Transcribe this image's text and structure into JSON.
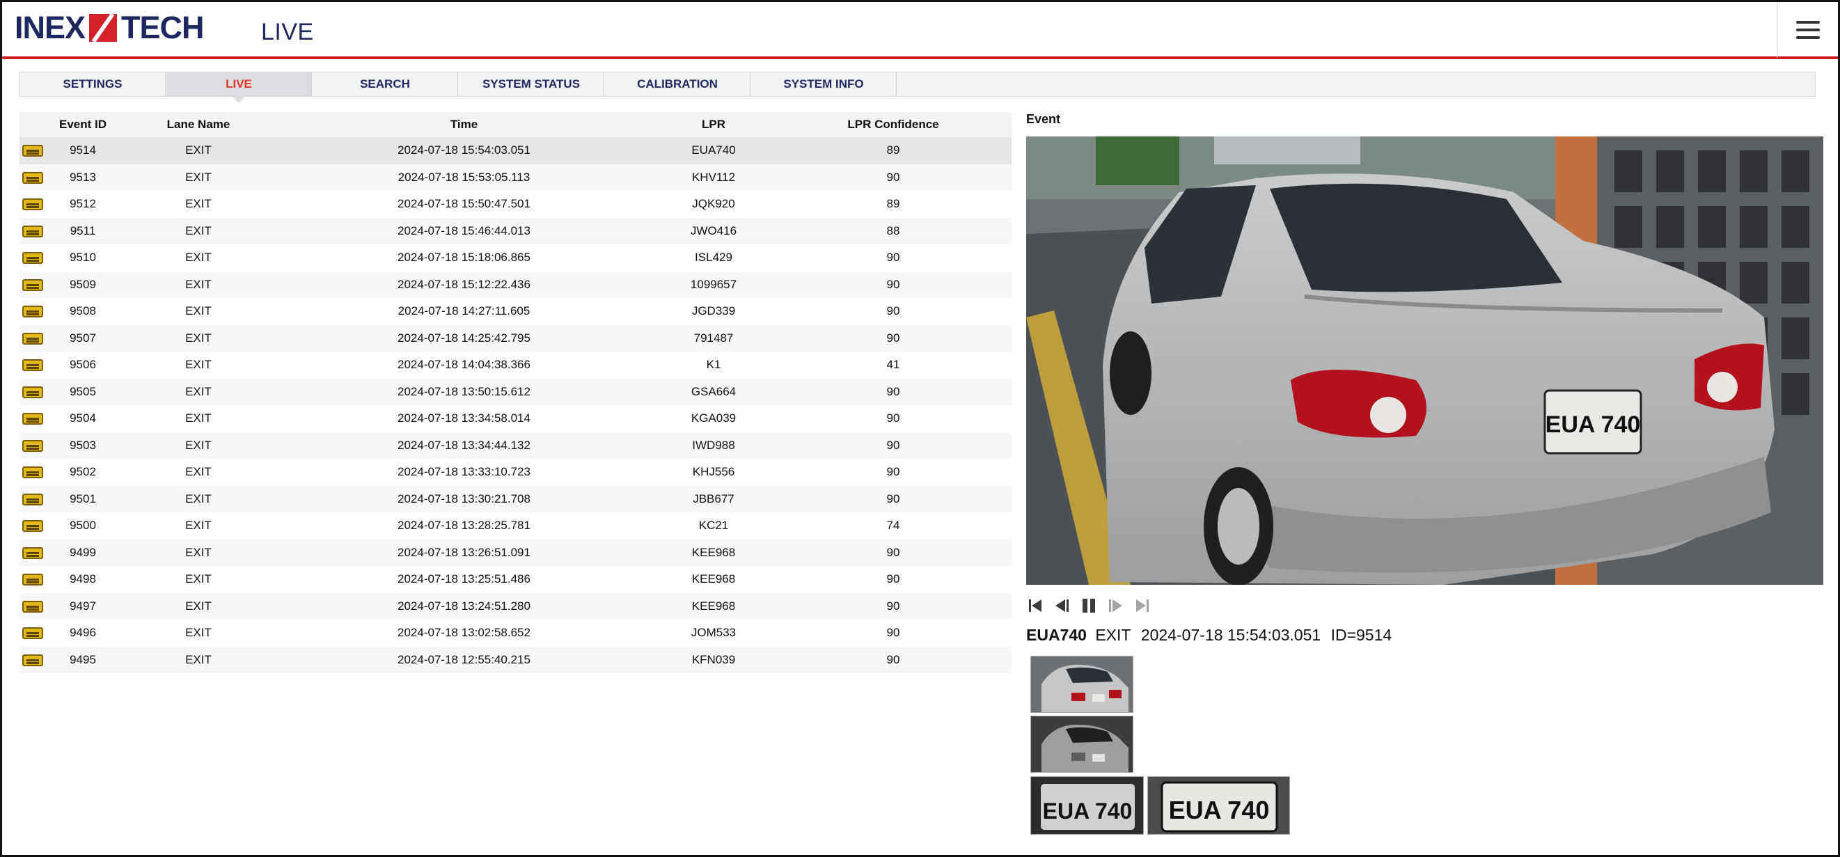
{
  "header": {
    "logo_left": "INEX",
    "logo_right": "TECH",
    "page_title": "LIVE"
  },
  "tabs": [
    {
      "label": "SETTINGS",
      "active": false
    },
    {
      "label": "LIVE",
      "active": true
    },
    {
      "label": "SEARCH",
      "active": false
    },
    {
      "label": "SYSTEM STATUS",
      "active": false
    },
    {
      "label": "CALIBRATION",
      "active": false
    },
    {
      "label": "SYSTEM INFO",
      "active": false
    }
  ],
  "table": {
    "columns": [
      "",
      "Event ID",
      "Lane Name",
      "Time",
      "LPR",
      "LPR Confidence"
    ],
    "rows": [
      {
        "id": "9514",
        "lane": "EXIT",
        "time": "2024-07-18 15:54:03.051",
        "lpr": "EUA740",
        "conf": "89"
      },
      {
        "id": "9513",
        "lane": "EXIT",
        "time": "2024-07-18 15:53:05.113",
        "lpr": "KHV112",
        "conf": "90"
      },
      {
        "id": "9512",
        "lane": "EXIT",
        "time": "2024-07-18 15:50:47.501",
        "lpr": "JQK920",
        "conf": "89"
      },
      {
        "id": "9511",
        "lane": "EXIT",
        "time": "2024-07-18 15:46:44.013",
        "lpr": "JWO416",
        "conf": "88"
      },
      {
        "id": "9510",
        "lane": "EXIT",
        "time": "2024-07-18 15:18:06.865",
        "lpr": "ISL429",
        "conf": "90"
      },
      {
        "id": "9509",
        "lane": "EXIT",
        "time": "2024-07-18 15:12:22.436",
        "lpr": "1099657",
        "conf": "90"
      },
      {
        "id": "9508",
        "lane": "EXIT",
        "time": "2024-07-18 14:27:11.605",
        "lpr": "JGD339",
        "conf": "90"
      },
      {
        "id": "9507",
        "lane": "EXIT",
        "time": "2024-07-18 14:25:42.795",
        "lpr": "791487",
        "conf": "90"
      },
      {
        "id": "9506",
        "lane": "EXIT",
        "time": "2024-07-18 14:04:38.366",
        "lpr": "K1",
        "conf": "41"
      },
      {
        "id": "9505",
        "lane": "EXIT",
        "time": "2024-07-18 13:50:15.612",
        "lpr": "GSA664",
        "conf": "90"
      },
      {
        "id": "9504",
        "lane": "EXIT",
        "time": "2024-07-18 13:34:58.014",
        "lpr": "KGA039",
        "conf": "90"
      },
      {
        "id": "9503",
        "lane": "EXIT",
        "time": "2024-07-18 13:34:44.132",
        "lpr": "IWD988",
        "conf": "90"
      },
      {
        "id": "9502",
        "lane": "EXIT",
        "time": "2024-07-18 13:33:10.723",
        "lpr": "KHJ556",
        "conf": "90"
      },
      {
        "id": "9501",
        "lane": "EXIT",
        "time": "2024-07-18 13:30:21.708",
        "lpr": "JBB677",
        "conf": "90"
      },
      {
        "id": "9500",
        "lane": "EXIT",
        "time": "2024-07-18 13:28:25.781",
        "lpr": "KC21",
        "conf": "74"
      },
      {
        "id": "9499",
        "lane": "EXIT",
        "time": "2024-07-18 13:26:51.091",
        "lpr": "KEE968",
        "conf": "90"
      },
      {
        "id": "9498",
        "lane": "EXIT",
        "time": "2024-07-18 13:25:51.486",
        "lpr": "KEE968",
        "conf": "90"
      },
      {
        "id": "9497",
        "lane": "EXIT",
        "time": "2024-07-18 13:24:51.280",
        "lpr": "KEE968",
        "conf": "90"
      },
      {
        "id": "9496",
        "lane": "EXIT",
        "time": "2024-07-18 13:02:58.652",
        "lpr": "JOM533",
        "conf": "90"
      },
      {
        "id": "9495",
        "lane": "EXIT",
        "time": "2024-07-18 12:55:40.215",
        "lpr": "KFN039",
        "conf": "90"
      }
    ]
  },
  "event": {
    "label": "Event",
    "plate": "EUA740",
    "lane": "EXIT",
    "time": "2024-07-18 15:54:03.051",
    "id_text": "ID=9514",
    "plate_text_in_image": "EUA 740"
  },
  "player": {
    "icons": [
      "skip-first-icon",
      "step-back-icon",
      "pause-icon",
      "step-forward-icon",
      "skip-last-icon"
    ]
  },
  "colors": {
    "brand_navy": "#1f2760",
    "brand_red": "#d4202a",
    "active_tab_text": "#e5322b"
  }
}
